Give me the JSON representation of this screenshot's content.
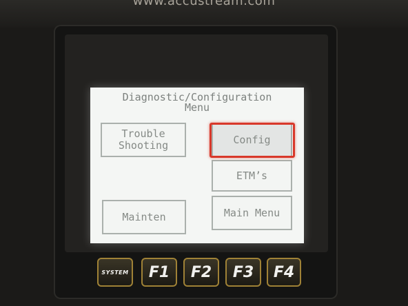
{
  "device": {
    "brand_url": "www.accustream.com"
  },
  "screen": {
    "title": "Diagnostic/Configuration\nMenu",
    "buttons": {
      "trouble_shooting": "Trouble\nShooting",
      "config": "Config",
      "etms": "ETM’s",
      "mainten": "Mainten",
      "main_menu": "Main Menu"
    },
    "highlight_color": "#d8382a"
  },
  "keys": {
    "system": "SYSTEM",
    "f1": "F1",
    "f2": "F2",
    "f3": "F3",
    "f4": "F4"
  },
  "colors": {
    "screen_bg": "#f4f6f4",
    "button_text": "#858a86",
    "key_border": "#a08236"
  }
}
